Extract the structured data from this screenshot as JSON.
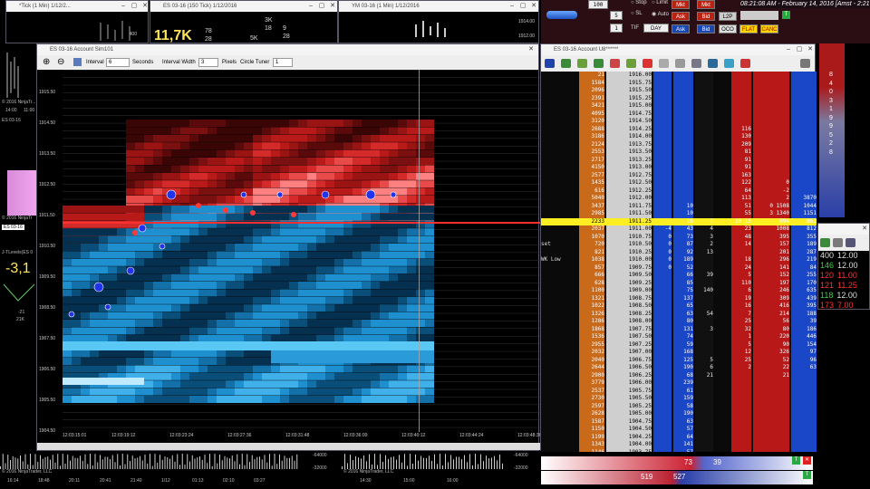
{
  "colors": {
    "bid": "#1a5fd8",
    "ask": "#c81414",
    "last": "#ffee22",
    "bg": "#000000"
  },
  "topwins": [
    {
      "title": "*Tick (1 Min)  1/12/2...",
      "val": "400"
    },
    {
      "title": "ES 03-16 (150 Tick)  1/12/2016",
      "big": "11,7K",
      "s1": "78",
      "s2": "28",
      "s3": "5K"
    },
    {
      "title": "",
      "s1": "3K",
      "s2": "18",
      "s3": "5K",
      "s4": "9",
      "s5": "28"
    },
    {
      "title": "YM 03-16 (1 Min)  1/12/2016",
      "v1": "1914.00",
      "v2": "1912.00"
    }
  ],
  "mini_left": {
    "copy": "© 2016 NinjaTr...",
    "time": "14:00",
    "t2": "11:00",
    "lbl": "ES 03-16",
    "copy2": "© 2016 NinjaTr",
    "lbl2": "ES 03-16",
    "sym": "J-TLevels(ES 0",
    "big": "-3,1",
    "v1": "-21",
    "v2": "21K"
  },
  "order_entry": {
    "qty1": "100",
    "qty2": "5",
    "qty3": "1",
    "stop": "Stop",
    "limit": "Limit",
    "sl": "SL",
    "auto": "Auto",
    "tif_lbl": "TIF",
    "tif": "DAY",
    "mkt1": "Mkt",
    "mkt2": "Mkt",
    "ask1": "Ask",
    "bid1": "Bid",
    "ask2": "Ask",
    "bid2": "Bid",
    "l2p": "L2P",
    "oco": "OCO",
    "flat": "FLAT",
    "canc": "CANC",
    "clock": "08:21:08 AM - February 14, 2016 [Amst - 2:21",
    "rv": [
      "8",
      "4",
      "0",
      "3",
      "1",
      "9",
      "9",
      "5",
      "2",
      "8"
    ]
  },
  "mainwin": {
    "title": "ES 03-16  Account Sim101",
    "interval_lbl": "Interval",
    "interval": "6",
    "seconds": "Seconds",
    "iw_lbl": "Interval Width",
    "iw": "3",
    "pixels": "Pixels",
    "ct_lbl": "Circle Tuner",
    "ct": "1"
  },
  "prices": [
    "1915.50",
    "1914.50",
    "1913.50",
    "1912.50",
    "1911.50",
    "1910.50",
    "1909.50",
    "1908.50",
    "1907.50",
    "1906.50",
    "1905.50",
    "1904.50"
  ],
  "times": [
    "12:03:15:01",
    "12:03:19:12",
    "12:03:23:24",
    "12:03:27:36",
    "12:03:31:48",
    "12:03:36:00",
    "12:03:40:12",
    "12:03:44:24",
    "12:03:48:36"
  ],
  "ladwin": {
    "title": "ES 03-16  Account U8******"
  },
  "ladder": [
    {
      "v": "21",
      "p": "1916.00",
      "a": "",
      "b": "",
      "c1": "",
      "c2": "",
      "r1": "",
      "r2": ""
    },
    {
      "v": "1584",
      "p": "1915.75",
      "a": "",
      "b": "",
      "c1": "",
      "c2": "",
      "r1": "",
      "r2": ""
    },
    {
      "v": "2096",
      "p": "1915.50",
      "a": "",
      "b": "",
      "c1": "",
      "c2": "",
      "r1": "",
      "r2": ""
    },
    {
      "v": "2391",
      "p": "1915.25",
      "a": "",
      "b": "",
      "c1": "",
      "c2": "",
      "r1": "",
      "r2": ""
    },
    {
      "v": "3421",
      "p": "1915.00",
      "a": "",
      "b": "",
      "c1": "",
      "c2": "",
      "r1": "",
      "r2": ""
    },
    {
      "v": "4095",
      "p": "1914.75",
      "a": "",
      "b": "",
      "c1": "",
      "c2": "",
      "r1": "",
      "r2": ""
    },
    {
      "v": "3120",
      "p": "1914.50",
      "a": "",
      "b": "",
      "c1": "",
      "c2": "",
      "r1": "",
      "r2": ""
    },
    {
      "v": "2688",
      "p": "1914.25",
      "a": "",
      "b": "",
      "c1": "",
      "c2": "116",
      "r1": "",
      "r2": ""
    },
    {
      "v": "3186",
      "p": "1914.00",
      "a": "",
      "b": "",
      "c1": "",
      "c2": "130",
      "r1": "",
      "r2": ""
    },
    {
      "v": "2124",
      "p": "1913.75",
      "a": "",
      "b": "",
      "c1": "",
      "c2": "209",
      "r1": "",
      "r2": ""
    },
    {
      "v": "2553",
      "p": "1913.50",
      "a": "",
      "b": "",
      "c1": "",
      "c2": "81",
      "r1": "",
      "r2": ""
    },
    {
      "v": "2717",
      "p": "1913.25",
      "a": "",
      "b": "",
      "c1": "",
      "c2": "91",
      "r1": "",
      "r2": ""
    },
    {
      "v": "4150",
      "p": "1913.00",
      "a": "",
      "b": "",
      "c1": "",
      "c2": "91",
      "r1": "",
      "r2": ""
    },
    {
      "v": "2577",
      "p": "1912.75",
      "a": "",
      "b": "",
      "c1": "",
      "c2": "163",
      "r1": "",
      "r2": ""
    },
    {
      "v": "1435",
      "p": "1912.50",
      "a": "",
      "b": "",
      "c1": "",
      "c2": "122",
      "r1": "0",
      "r2": ""
    },
    {
      "v": "616",
      "p": "1912.25",
      "a": "",
      "b": "",
      "c1": "",
      "c2": "64",
      "r1": "-2",
      "r2": ""
    },
    {
      "v": "5040",
      "p": "1912.00",
      "a": "",
      "b": "",
      "c1": "",
      "c2": "113",
      "r1": "2",
      "r2": "3870"
    },
    {
      "v": "3437",
      "p": "1911.75",
      "a": "",
      "b": "10",
      "c1": "",
      "c2": "51",
      "r1": "0 1508",
      "r2": "1044"
    },
    {
      "v": "2985",
      "p": "1911.50",
      "a": "",
      "b": "10",
      "c1": "",
      "c2": "55",
      "r1": "3 1340",
      "r2": "1151"
    },
    {
      "v": "2233",
      "p": "1911.25",
      "a": "",
      "b": "16",
      "c1": "7",
      "c2": "10 15",
      "r1": "994",
      "r2": "862",
      "hl": true
    },
    {
      "v": "2037",
      "p": "1911.00",
      "a": "-4",
      "b": "43",
      "c1": "4",
      "c2": "23",
      "r1": "1008",
      "r2": "812"
    },
    {
      "v": "1070",
      "p": "1910.75",
      "a": "0",
      "b": "73",
      "c1": "3",
      "c2": "48",
      "r1": "395",
      "r2": "355"
    },
    {
      "v": "720",
      "p": "1910.50",
      "a": "0",
      "b": "87",
      "c1": "2",
      "c2": "14",
      "r1": "157",
      "r2": "189",
      "lbl": "set"
    },
    {
      "v": "821",
      "p": "1910.25",
      "a": "0",
      "b": "92",
      "c1": "13",
      "c2": "",
      "r1": "201",
      "r2": "287"
    },
    {
      "v": "1038",
      "p": "1910.00",
      "a": "0",
      "b": "189",
      "c1": "",
      "c2": "18",
      "r1": "296",
      "r2": "219",
      "lbl": "WK Low"
    },
    {
      "v": "857",
      "p": "1909.75",
      "a": "0",
      "b": "52",
      "c1": "",
      "c2": "24",
      "r1": "141",
      "r2": "84"
    },
    {
      "v": "666",
      "p": "1909.50",
      "a": "",
      "b": "66",
      "c1": "39",
      "c2": "5",
      "r1": "152",
      "r2": "255"
    },
    {
      "v": "628",
      "p": "1909.25",
      "a": "",
      "b": "85",
      "c1": "",
      "c2": "110",
      "r1": "197",
      "r2": "170"
    },
    {
      "v": "1100",
      "p": "1909.00",
      "a": "",
      "b": "75",
      "c1": "140",
      "c2": "6",
      "r1": "246",
      "r2": "635"
    },
    {
      "v": "1321",
      "p": "1908.75",
      "a": "",
      "b": "137",
      "c1": "",
      "c2": "19",
      "r1": "309",
      "r2": "439"
    },
    {
      "v": "1022",
      "p": "1908.50",
      "a": "",
      "b": "65",
      "c1": "",
      "c2": "16",
      "r1": "416",
      "r2": "395"
    },
    {
      "v": "1326",
      "p": "1908.25",
      "a": "",
      "b": "63",
      "c1": "54",
      "c2": "7",
      "r1": "214",
      "r2": "188"
    },
    {
      "v": "1286",
      "p": "1908.00",
      "a": "",
      "b": "80",
      "c1": "",
      "c2": "25",
      "r1": "56",
      "r2": "39"
    },
    {
      "v": "1868",
      "p": "1907.75",
      "a": "",
      "b": "131",
      "c1": "3",
      "c2": "32",
      "r1": "80",
      "r2": "186"
    },
    {
      "v": "1536",
      "p": "1907.50",
      "a": "",
      "b": "74",
      "c1": "",
      "c2": "1",
      "r1": "220",
      "r2": "446"
    },
    {
      "v": "2955",
      "p": "1907.25",
      "a": "",
      "b": "59",
      "c1": "",
      "c2": "5",
      "r1": "90",
      "r2": "154"
    },
    {
      "v": "2032",
      "p": "1907.00",
      "a": "",
      "b": "168",
      "c1": "",
      "c2": "12",
      "r1": "326",
      "r2": "97"
    },
    {
      "v": "2040",
      "p": "1906.75",
      "a": "",
      "b": "125",
      "c1": "5",
      "c2": "25",
      "r1": "52",
      "r2": "96"
    },
    {
      "v": "2644",
      "p": "1906.50",
      "a": "",
      "b": "190",
      "c1": "6",
      "c2": "2",
      "r1": "22",
      "r2": "63"
    },
    {
      "v": "2900",
      "p": "1906.25",
      "a": "",
      "b": "68",
      "c1": "21",
      "c2": "",
      "r1": "21",
      "r2": ""
    },
    {
      "v": "3779",
      "p": "1906.00",
      "a": "",
      "b": "239",
      "c1": "",
      "c2": "",
      "r1": "",
      "r2": ""
    },
    {
      "v": "2537",
      "p": "1905.75",
      "a": "",
      "b": "61",
      "c1": "",
      "c2": "",
      "r1": "",
      "r2": ""
    },
    {
      "v": "2730",
      "p": "1905.50",
      "a": "",
      "b": "159",
      "c1": "",
      "c2": "",
      "r1": "",
      "r2": ""
    },
    {
      "v": "2597",
      "p": "1905.25",
      "a": "",
      "b": "58",
      "c1": "",
      "c2": "",
      "r1": "",
      "r2": ""
    },
    {
      "v": "2628",
      "p": "1905.00",
      "a": "",
      "b": "190",
      "c1": "",
      "c2": "",
      "r1": "",
      "r2": ""
    },
    {
      "v": "1587",
      "p": "1904.75",
      "a": "",
      "b": "63",
      "c1": "",
      "c2": "",
      "r1": "",
      "r2": ""
    },
    {
      "v": "1150",
      "p": "1904.50",
      "a": "",
      "b": "57",
      "c1": "",
      "c2": "",
      "r1": "",
      "r2": ""
    },
    {
      "v": "1199",
      "p": "1904.25",
      "a": "",
      "b": "64",
      "c1": "",
      "c2": "",
      "r1": "",
      "r2": ""
    },
    {
      "v": "1343",
      "p": "1904.00",
      "a": "",
      "b": "141",
      "c1": "",
      "c2": "",
      "r1": "",
      "r2": ""
    },
    {
      "v": "1146",
      "p": "1903.75",
      "a": "",
      "b": "57",
      "c1": "",
      "c2": "",
      "r1": "",
      "r2": ""
    }
  ],
  "right_list": [
    {
      "a": "400",
      "b": "12.00"
    },
    {
      "a": "146",
      "b": "12.00"
    },
    {
      "a": "120",
      "b": "11.00"
    },
    {
      "a": "121",
      "b": "11.25"
    },
    {
      "a": "118",
      "b": "12.00"
    },
    {
      "a": "173",
      "b": "7.00"
    }
  ],
  "bottom_right": {
    "ask_val": "73",
    "bid_val": "39",
    "ask_tot": "519",
    "bid_tot": "527"
  },
  "bottom_left": {
    "copy": "© 2016 NinjaTrader, LLC",
    "times": [
      "16:14",
      "18:48",
      "20:11",
      "20:41",
      "21:40",
      "1/12",
      "01:13",
      "02:10",
      "03:27"
    ],
    "val1": "-64000",
    "val2": "-32000"
  },
  "bottom_mid": {
    "copy": "© 2016 NinjaTrader, LLC",
    "times": [
      "14:30",
      "15:00",
      "16:00"
    ],
    "val1": "-64000",
    "val2": "-32000"
  }
}
